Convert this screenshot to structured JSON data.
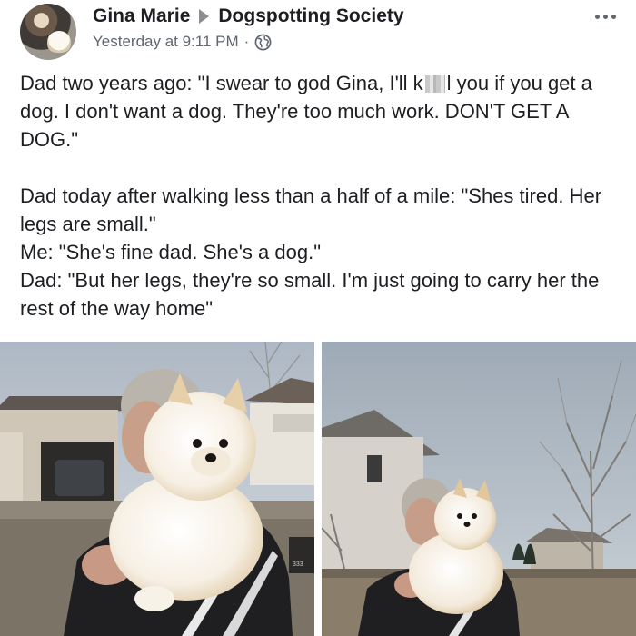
{
  "post": {
    "author": "Gina Marie",
    "group": "Dogspotting Society",
    "timestamp": "Yesterday at 9:11 PM",
    "separator": "·",
    "icons": {
      "avatar": "profile-photo",
      "arrow": "right-arrow-icon",
      "privacy": "globe-icon",
      "menu": "more-options-icon"
    },
    "text": {
      "p1_before": "Dad two years ago: \"I swear to god Gina, I'll k",
      "p1_after": "l you if you get a dog. I don't want a dog. They're too much work. DON'T GET A DOG.\"",
      "p2_l1": "Dad today after walking less than a half of a mile: \"Shes tired. Her legs are small.\"",
      "p2_l2": "Me: \"She's fine dad. She's a dog.\"",
      "p2_l3": "Dad: \"But her legs, they're so small. I'm just going to carry her the rest of the way home\""
    },
    "photos": {
      "left": "man-holding-pomeranian-photo",
      "right": "man-holding-pomeranian-wide-photo",
      "mailbox_number": "333"
    }
  }
}
